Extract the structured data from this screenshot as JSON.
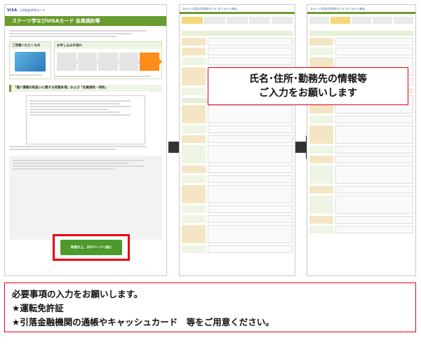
{
  "left_page": {
    "brand": "VISA",
    "brand_sub": "三井住友VISAカード",
    "title": "ステーツ学なびVISAカード 会員規約等",
    "col_a_heading": "ご用意いただくもの",
    "col_b_heading": "お申し込みの流れ",
    "section_heading": "「個人情報の取扱いに関する同意条項」および「会員規約・特約」",
    "cta_label": "同意の上、次のページへ進む"
  },
  "mid_page": {
    "header": "ステーツ学なびVISAカード オンライン申込"
  },
  "right_page": {
    "header": "ステーツ学なびVISAカード オンライン申込"
  },
  "callout": {
    "line1": "氏名･住所･勤務先の情報等",
    "line2": "ご入力をお願いします"
  },
  "notice": {
    "line1": "必要事項の入力をお願いします。",
    "line2": "★運転免許証",
    "line3": "★引落金融機関の通帳やキャッシュカード　等をご用意ください。"
  },
  "colors": {
    "brand_green": "#6a9b2e",
    "cta_green": "#4c9a2a",
    "highlight_red": "#e60012",
    "flow_orange": "#ff8c1a"
  }
}
